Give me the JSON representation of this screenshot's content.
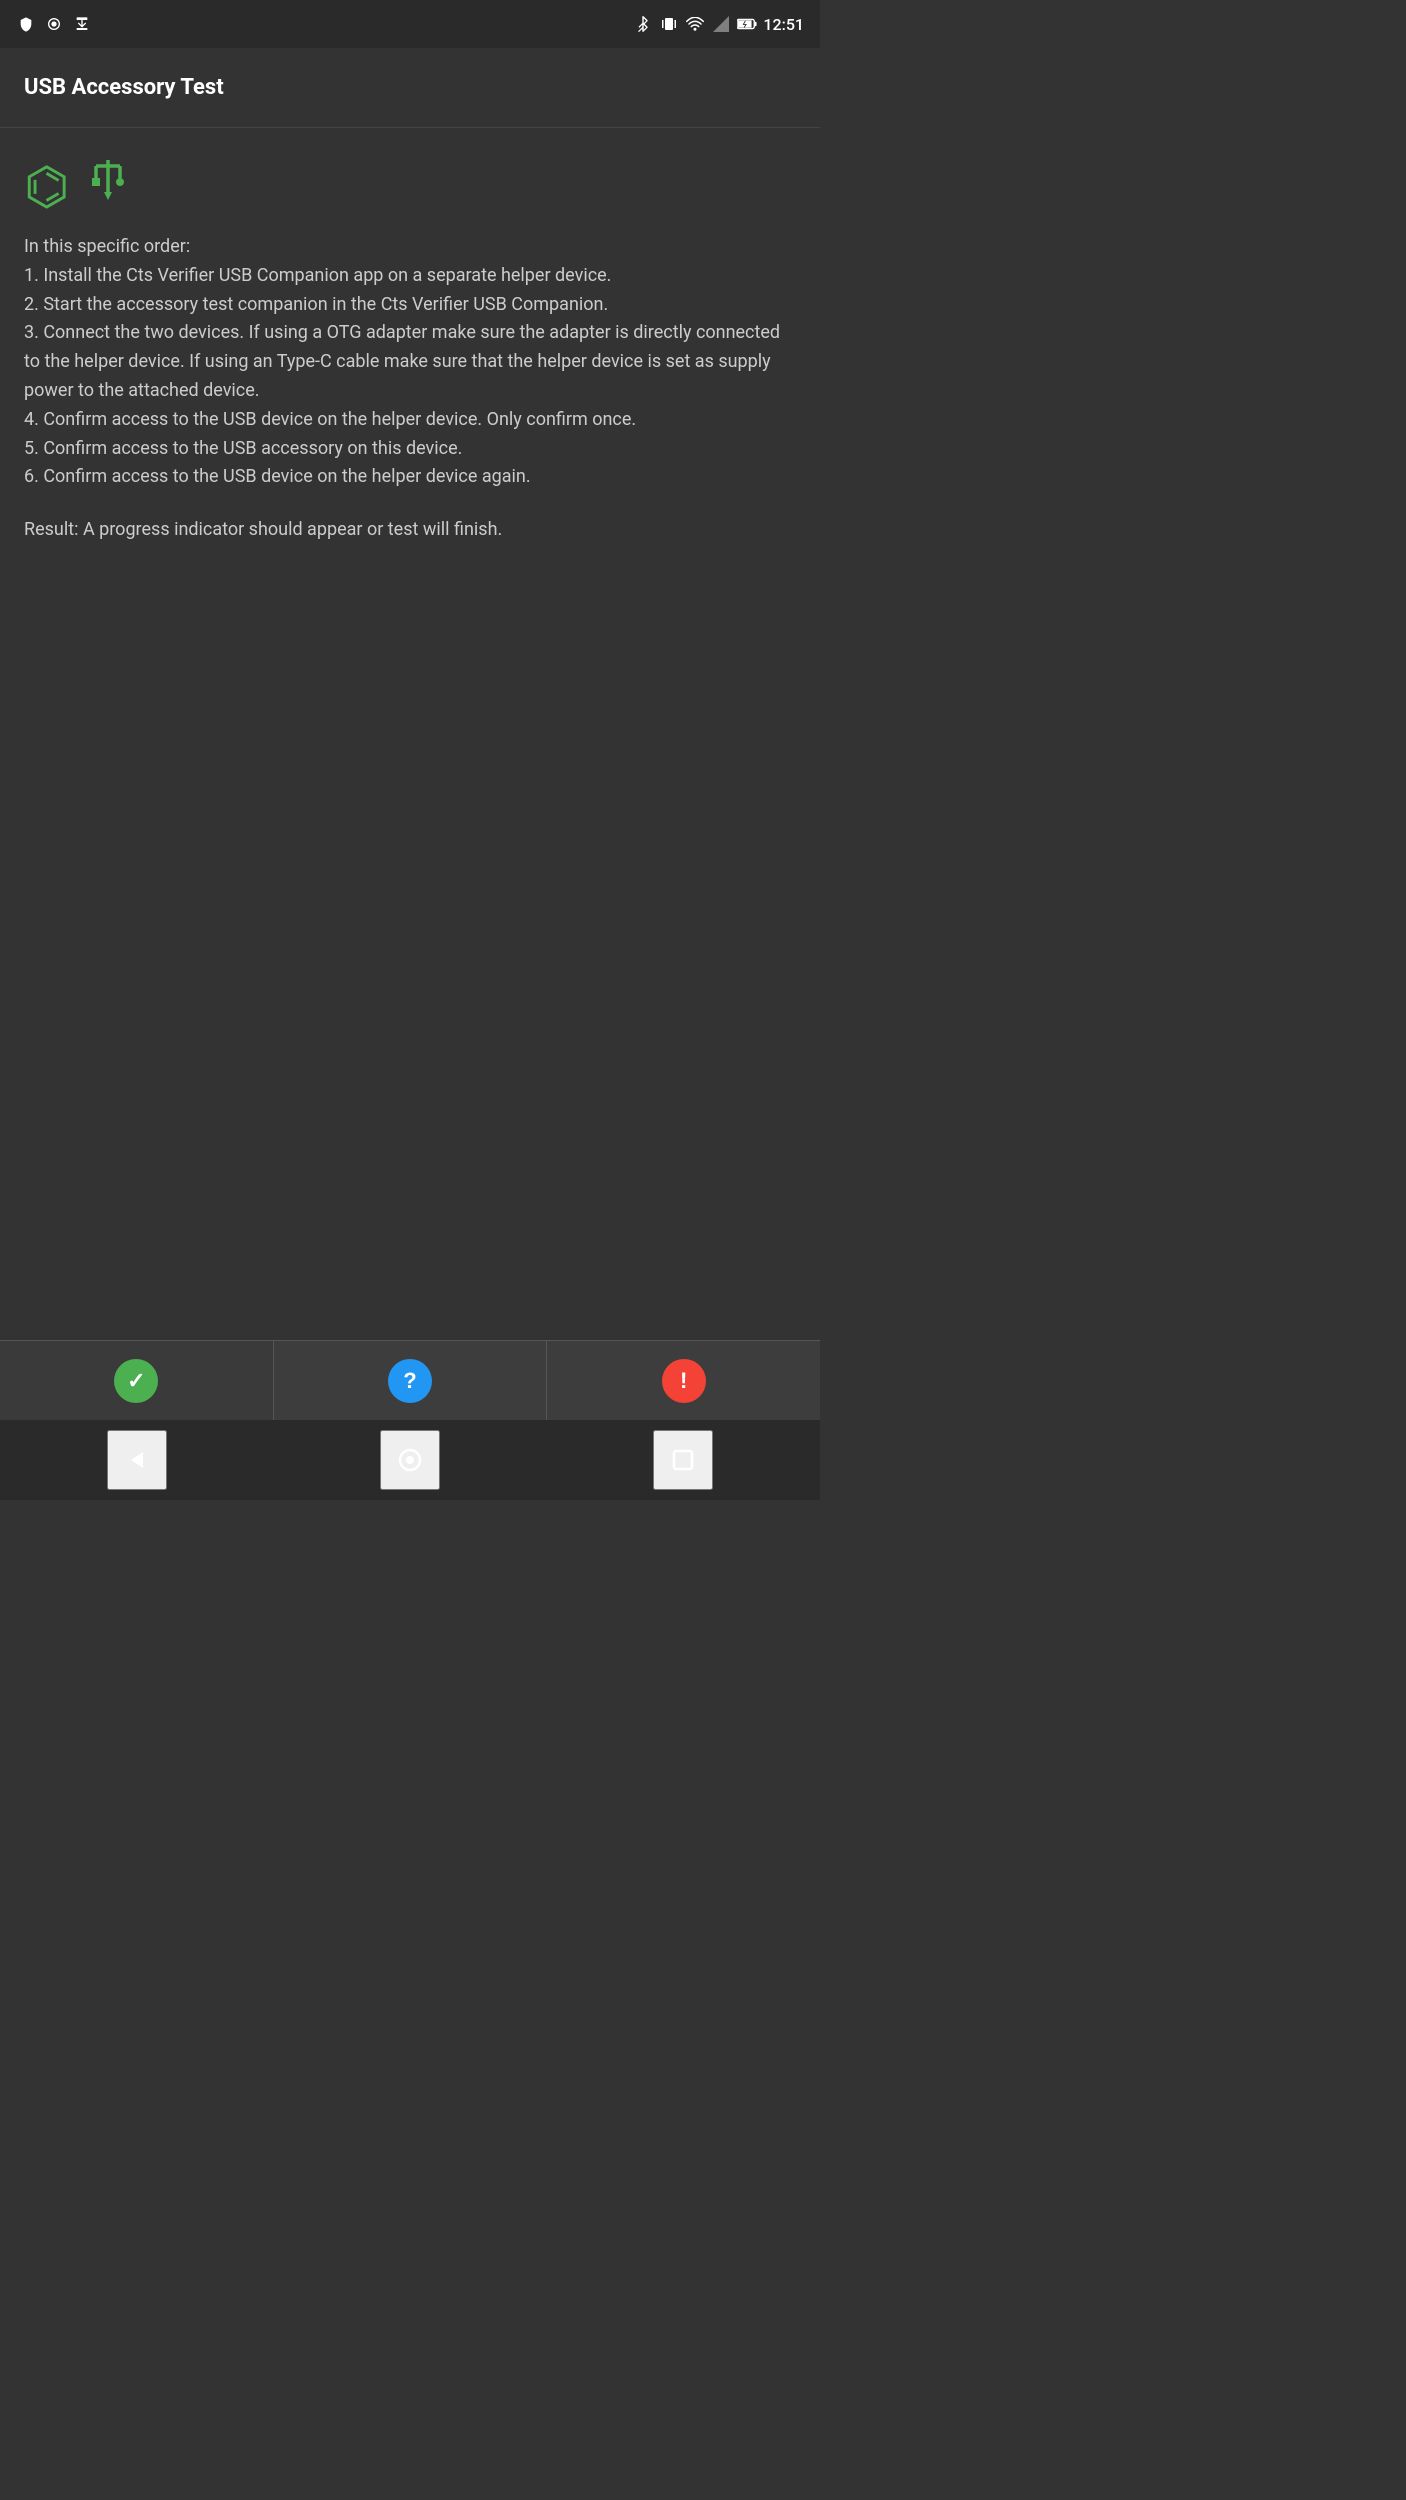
{
  "statusBar": {
    "time": "12:51",
    "icons": [
      "shield",
      "record",
      "download",
      "bluetooth",
      "vibrate",
      "wifi",
      "signal",
      "battery"
    ]
  },
  "appBar": {
    "title": "USB Accessory Test"
  },
  "content": {
    "usbIconLabel": "usb",
    "instructions": "In this specific order:\n1. Install the Cts Verifier USB Companion app on a separate helper device.\n2. Start the accessory test companion in the Cts Verifier USB Companion.\n3. Connect the two devices. If using a OTG adapter make sure the adapter is directly connected to the helper device. If using an Type-C cable make sure that the helper device is set as supply power to the attached device.\n4. Confirm access to the USB device on the helper device. Only confirm once.\n5. Confirm access to the USB accessory on this device.\n6. Confirm access to the USB device on the helper device again.",
    "result": "Result: A progress indicator should appear or test will finish."
  },
  "bottomButtons": {
    "pass": {
      "label": "pass",
      "icon": "✓",
      "color": "#4caf50"
    },
    "info": {
      "label": "info",
      "icon": "?",
      "color": "#2196f3"
    },
    "fail": {
      "label": "fail",
      "icon": "!",
      "color": "#f44336"
    }
  },
  "navBar": {
    "back": "◀",
    "home": "○",
    "recents": "□"
  }
}
